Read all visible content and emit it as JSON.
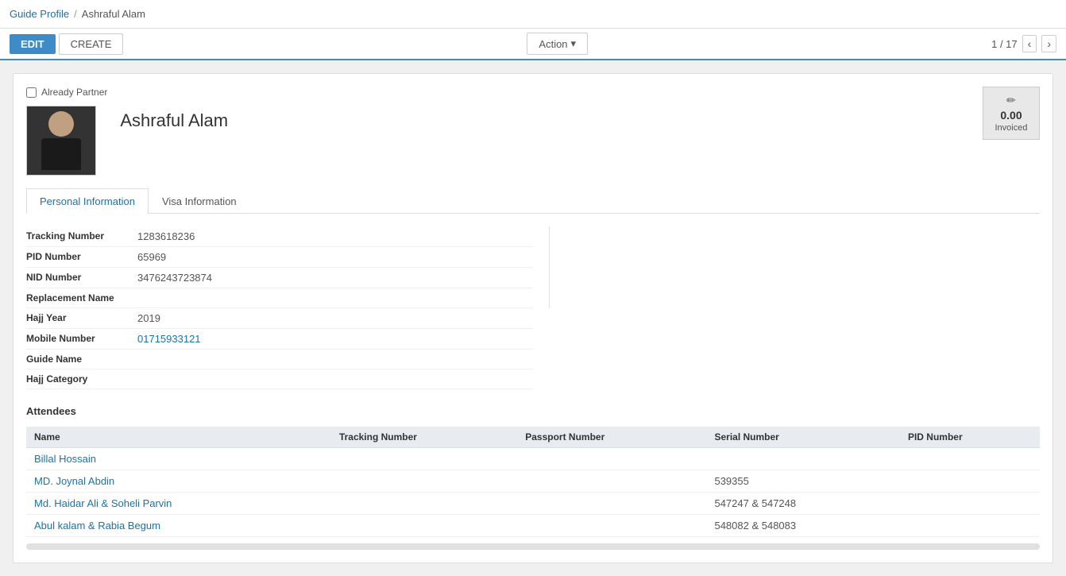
{
  "breadcrumb": {
    "parent_label": "Guide Profile",
    "separator": "/",
    "current_label": "Ashraful Alam"
  },
  "toolbar": {
    "edit_label": "EDIT",
    "create_label": "CREATE",
    "action_label": "Action",
    "pagination_current": "1",
    "pagination_total": "17"
  },
  "record": {
    "already_partner_label": "Already Partner",
    "name": "Ashraful Alam",
    "invoiced_amount": "0.00",
    "invoiced_label": "Invoiced"
  },
  "tabs": {
    "personal_info_label": "Personal Information",
    "visa_info_label": "Visa Information"
  },
  "personal_info": {
    "left": {
      "tracking_number_label": "Tracking Number",
      "tracking_number_value": "1283618236",
      "pid_number_label": "PID Number",
      "pid_number_value": "65969",
      "nid_number_label": "NID Number",
      "nid_number_value": "3476243723874",
      "replacement_name_label": "Replacement Name",
      "replacement_name_value": ""
    },
    "right": {
      "hajj_year_label": "Hajj Year",
      "hajj_year_value": "2019",
      "mobile_number_label": "Mobile Number",
      "mobile_number_value": "01715933121",
      "guide_name_label": "Guide Name",
      "guide_name_value": "",
      "hajj_category_label": "Hajj Category",
      "hajj_category_value": ""
    }
  },
  "attendees": {
    "section_label": "Attendees",
    "columns": [
      "Name",
      "Tracking Number",
      "Passport Number",
      "Serial Number",
      "PID Number"
    ],
    "rows": [
      {
        "name": "Billal Hossain",
        "tracking_number": "",
        "passport_number": "",
        "serial_number": "",
        "pid_number": ""
      },
      {
        "name": "MD. Joynal Abdin",
        "tracking_number": "",
        "passport_number": "",
        "serial_number": "539355",
        "pid_number": ""
      },
      {
        "name": "Md. Haidar Ali & Soheli Parvin",
        "tracking_number": "",
        "passport_number": "",
        "serial_number": "547247 & 547248",
        "pid_number": ""
      },
      {
        "name": "Abul kalam & Rabia Begum",
        "tracking_number": "",
        "passport_number": "",
        "serial_number": "548082 & 548083",
        "pid_number": ""
      }
    ]
  }
}
